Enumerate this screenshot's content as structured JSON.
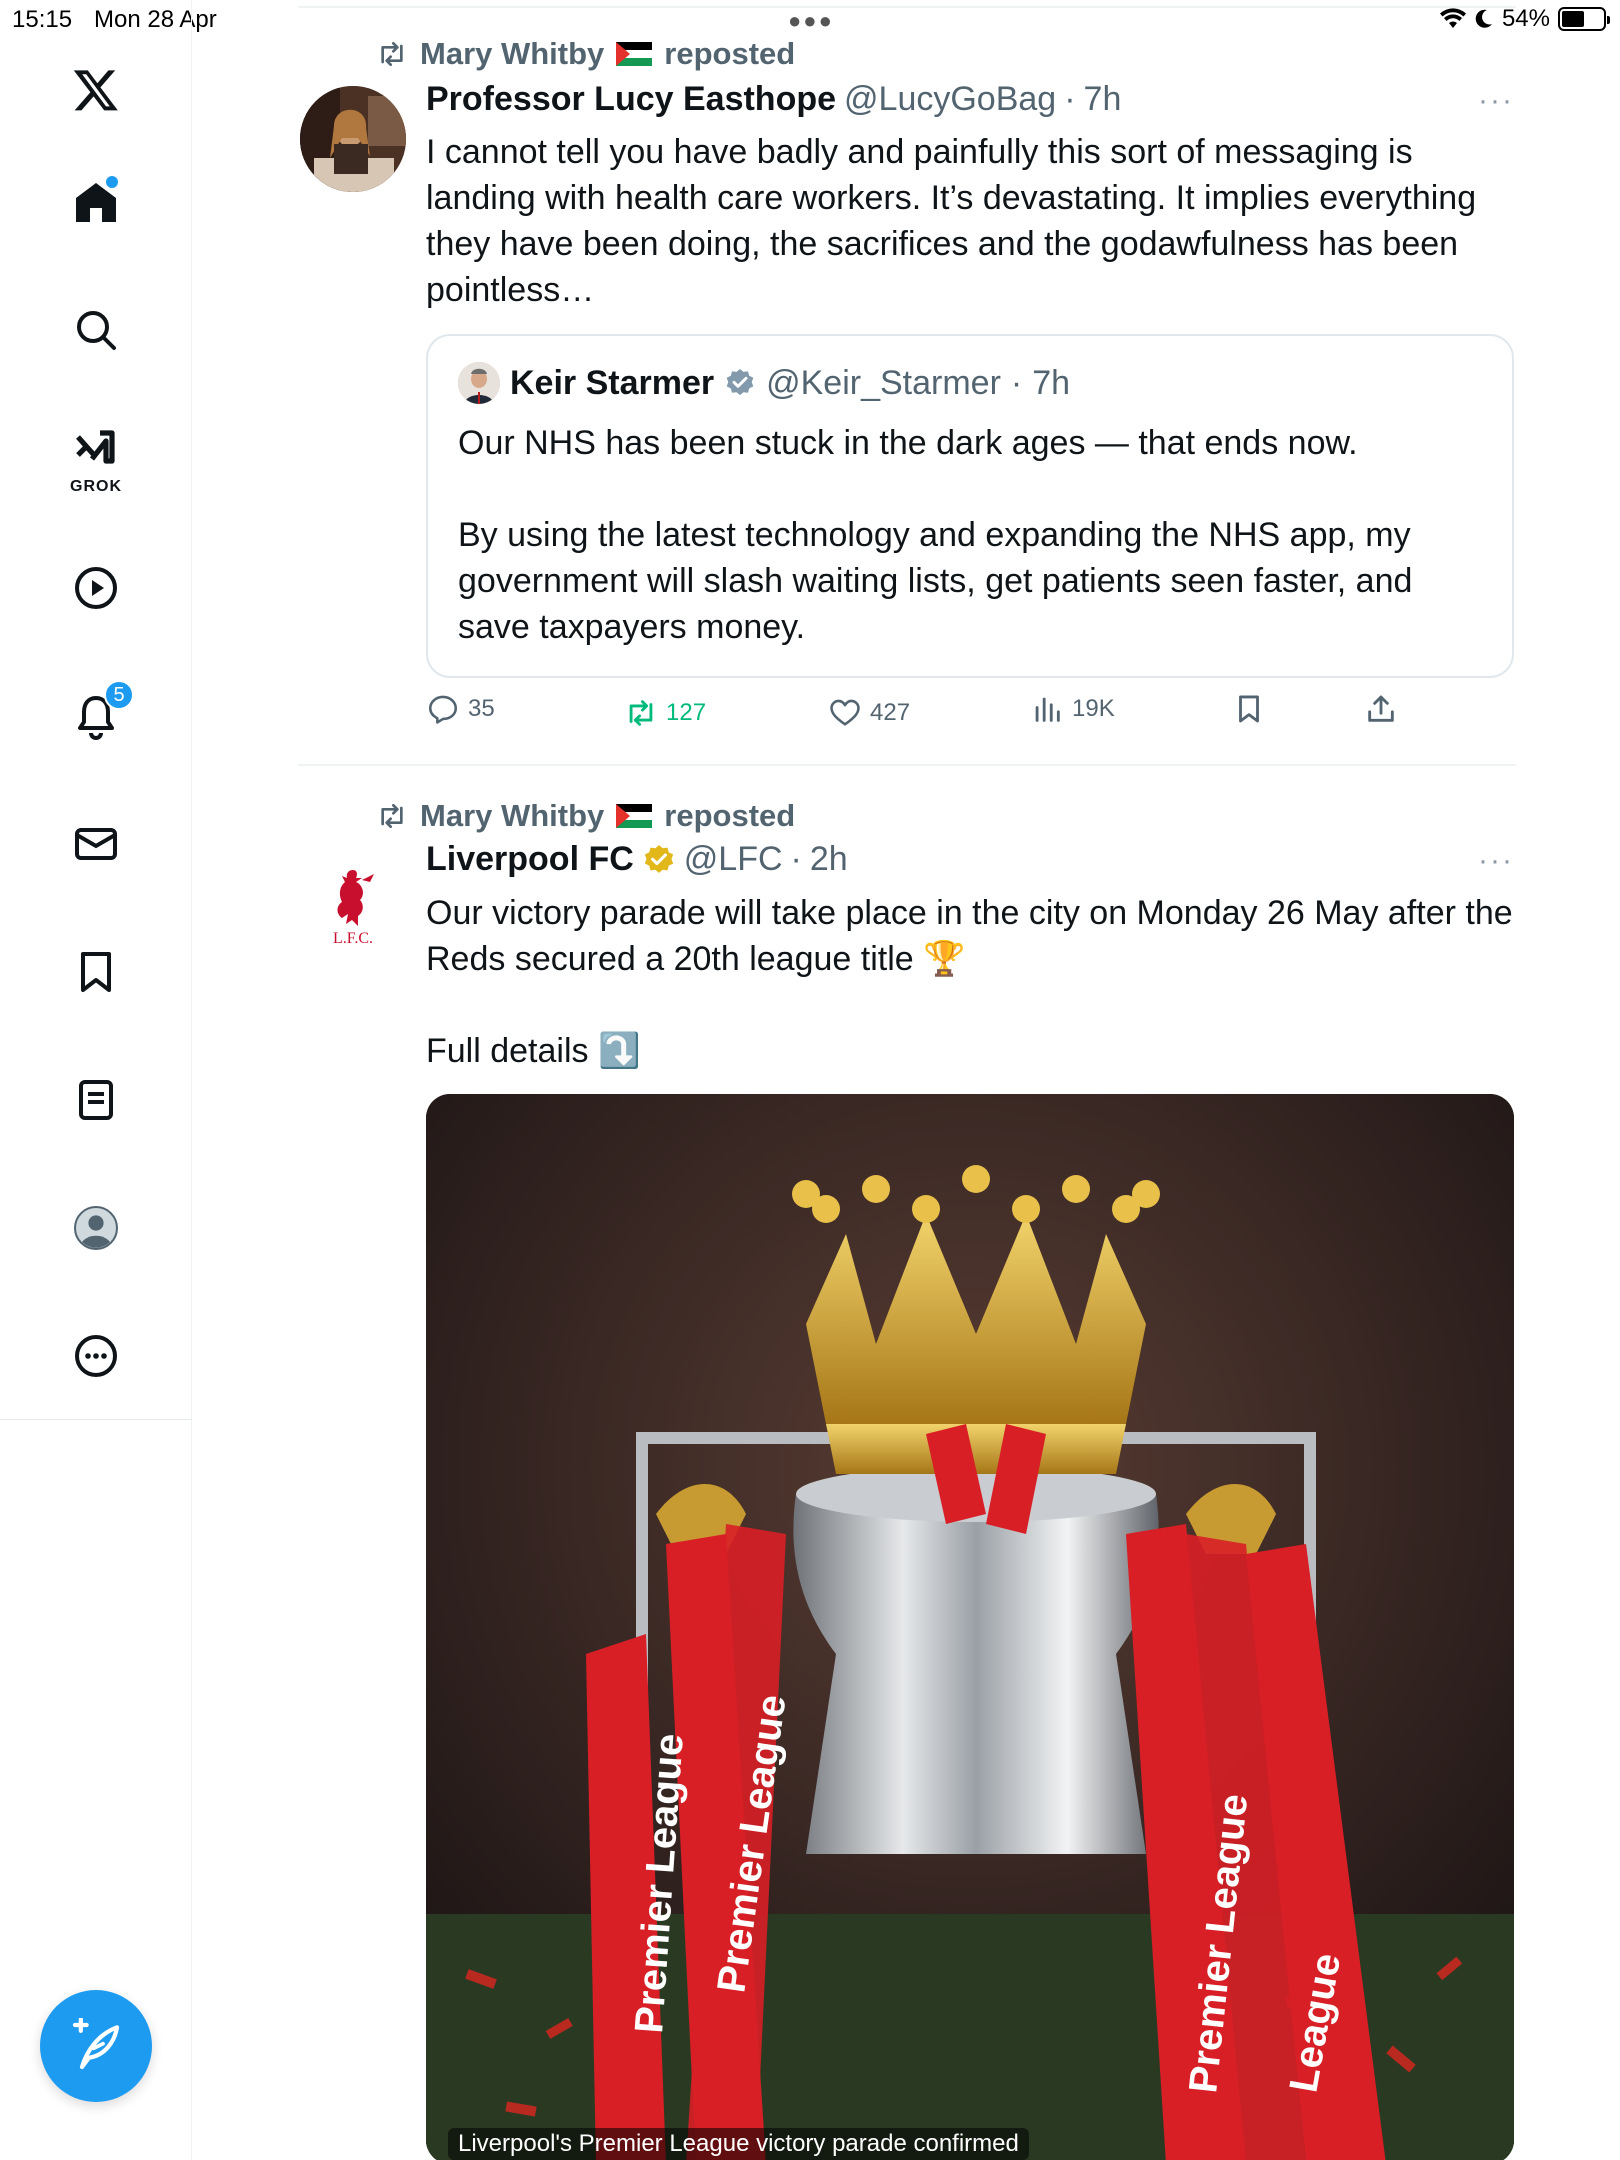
{
  "status_bar": {
    "time": "15:15",
    "date": "Mon 28 Apr",
    "battery": "54%",
    "battery_level": 0.54
  },
  "sidebar": {
    "items": [
      {
        "name": "x-logo",
        "label": ""
      },
      {
        "name": "home",
        "label": ""
      },
      {
        "name": "search",
        "label": ""
      },
      {
        "name": "grok",
        "label": "GROK"
      },
      {
        "name": "videos",
        "label": ""
      },
      {
        "name": "notifications",
        "label": "",
        "badge": "5"
      },
      {
        "name": "messages",
        "label": ""
      },
      {
        "name": "bookmarks",
        "label": ""
      },
      {
        "name": "lists",
        "label": ""
      },
      {
        "name": "profile",
        "label": ""
      },
      {
        "name": "more",
        "label": ""
      }
    ],
    "compose_icon": "feather-plus-icon",
    "accent_color": "#1d9bf0"
  },
  "tweets": [
    {
      "repost_by": "Mary Whitby",
      "repost_suffix": "reposted",
      "author_name": "Professor Lucy Easthope",
      "handle": "@LucyGoBag",
      "separator": "·",
      "time": "7h",
      "more": "···",
      "text": "I cannot tell you have badly and painfully this sort of messaging is landing with health care workers. It’s devastating. It implies everything they have been doing, the sacrifices and the godawfulness has been pointless…",
      "quote": {
        "author_name": "Keir Starmer",
        "verified": "grey",
        "handle": "@Keir_Starmer",
        "separator": "·",
        "time": "7h",
        "text": "Our NHS has been stuck in the dark ages — that ends now.\n\nBy using the latest technology and expanding the NHS app, my government will slash waiting lists, get patients seen faster, and save taxpayers money."
      },
      "stats": {
        "replies": "35",
        "reposts": "127",
        "likes": "427",
        "views": "19K"
      }
    },
    {
      "repost_by": "Mary Whitby",
      "repost_suffix": "reposted",
      "author_name": "Liverpool FC",
      "verified": "gold",
      "handle": "@LFC",
      "separator": "·",
      "time": "2h",
      "more": "···",
      "text": "Our victory parade will take place in the city on Monday 26 May after the Reds secured a 20th league title 🏆\n\nFull details ⤵️",
      "avatar_text": "L.F.C.",
      "media_caption": "Liverpool's Premier League victory parade confirmed",
      "media_ribbon_text": [
        "Premier League",
        "Premier League",
        "Premier League",
        "League"
      ]
    }
  ]
}
